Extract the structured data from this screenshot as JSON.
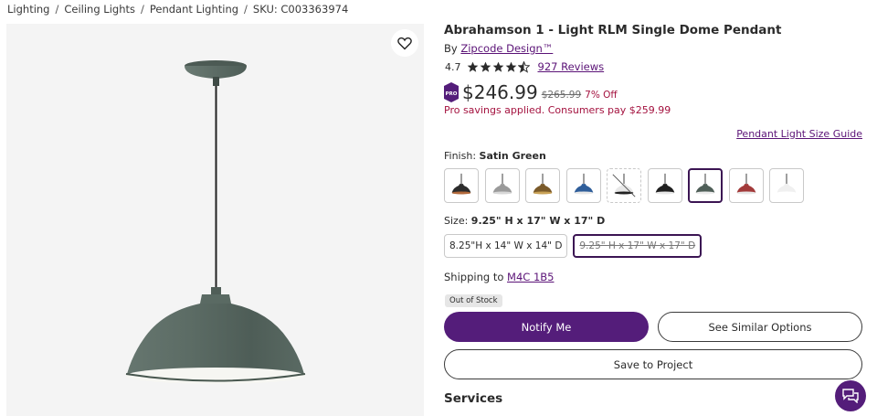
{
  "breadcrumb": {
    "items": [
      "Lighting",
      "Ceiling Lights",
      "Pendant Lighting"
    ],
    "sku": "SKU: C003363974",
    "separator": "/"
  },
  "product": {
    "title": "Abrahamson 1 - Light RLM Single Dome Pendant",
    "by_prefix": "By",
    "brand": "Zipcode Design™",
    "rating": "4.7",
    "rating_stars": 4.5,
    "reviews": "927 Reviews",
    "price": "$246.99",
    "old_price": "$265.99",
    "discount": "7% Off",
    "pro_badge": "PRO",
    "pro_savings": "Pro savings applied. Consumers pay $259.99"
  },
  "size_guide": "Pendant Light Size Guide",
  "finish": {
    "label": "Finish:",
    "value": "Satin Green",
    "swatches": [
      {
        "name": "black-copper",
        "shade": "#2c2c2c",
        "inner": "#b36a3c"
      },
      {
        "name": "galvanized",
        "shade": "#9a9a9a",
        "inner": "#d8d8d8"
      },
      {
        "name": "bronze",
        "shade": "#7a5a2a",
        "inner": "#c9a257"
      },
      {
        "name": "cobalt-blue",
        "shade": "#2f5e9a",
        "inner": "#e8e8e8"
      },
      {
        "name": "white-black",
        "shade": "#e8e8e8",
        "inner": "#222222"
      },
      {
        "name": "black",
        "shade": "#1f1f1f",
        "inner": "#e8e8e8"
      },
      {
        "name": "satin-green",
        "shade": "#4f5f58",
        "inner": "#ececec"
      },
      {
        "name": "red",
        "shade": "#a23a3a",
        "inner": "#e8e8e8"
      },
      {
        "name": "white",
        "shade": "#f0f0f0",
        "inner": "#ffffff"
      }
    ],
    "selected_index": 6,
    "unavailable_index": 4
  },
  "size": {
    "label": "Size:",
    "value": "9.25\" H x 17\" W x 17\" D",
    "options": [
      "8.25\"H x 14\" W x 14\" D",
      "9.25\" H x 17\" W x 17\" D"
    ]
  },
  "shipping": {
    "prefix": "Shipping to",
    "postal": "M4C 1B5"
  },
  "stock": "Out of Stock",
  "buttons": {
    "notify": "Notify Me",
    "similar": "See Similar Options",
    "save": "Save to Project"
  },
  "services": "Services",
  "colors": {
    "accent": "#541d7a",
    "sale": "#a4123f",
    "shade_green": "#55655e"
  }
}
